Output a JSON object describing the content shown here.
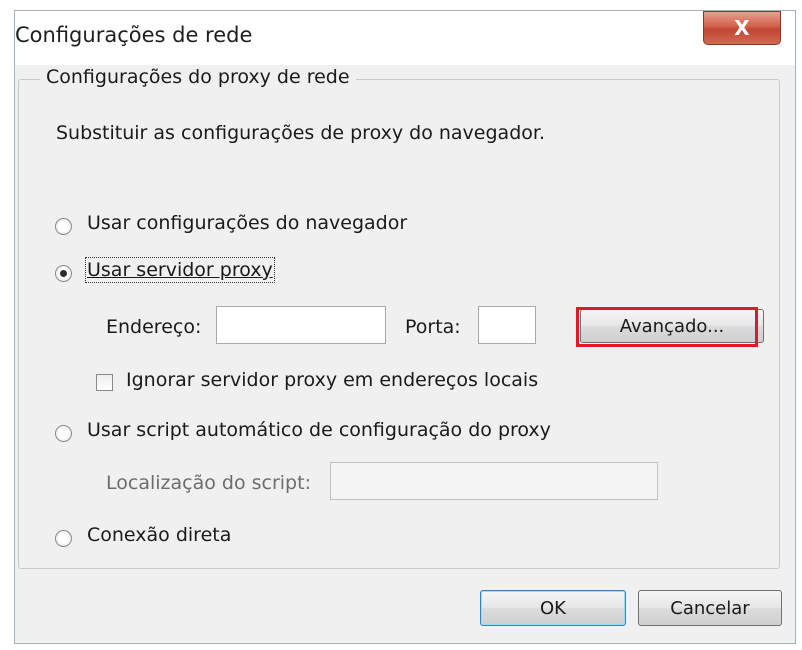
{
  "window": {
    "title": "Configurações de rede",
    "close_glyph": "X"
  },
  "group": {
    "legend": "Configurações do proxy de rede",
    "description": "Substituir as configurações de proxy do navegador."
  },
  "options": {
    "use_browser": {
      "label": "Usar configurações do navegador",
      "checked": false
    },
    "use_proxy": {
      "label": "Usar servidor proxy",
      "checked": true
    },
    "auto_script": {
      "label": "Usar script automático de configuração do proxy",
      "checked": false
    },
    "direct": {
      "label": "Conexão direta",
      "checked": false
    }
  },
  "proxy": {
    "address_label": "Endereço:",
    "address_value": "",
    "port_label": "Porta:",
    "port_value": "",
    "advanced_button": "Avançado...",
    "bypass_local_label": "Ignorar servidor proxy em endereços locais",
    "bypass_local_checked": false
  },
  "script": {
    "location_label": "Localização do script:",
    "location_value": ""
  },
  "footer": {
    "ok_label": "OK",
    "cancel_label": "Cancelar"
  },
  "colors": {
    "highlight": "#e01a22",
    "close_button": "#c24531",
    "dialog_background": "#f0f0f0"
  }
}
